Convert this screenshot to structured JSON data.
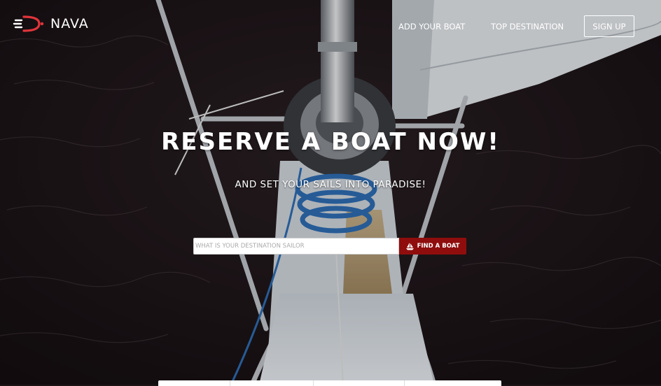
{
  "brand": {
    "name": "NAVA",
    "icon": "boat-logo-icon",
    "accent": "#e0353b"
  },
  "nav": {
    "add_boat": "ADD YOUR BOAT",
    "top_destination": "TOP DESTINATION",
    "sign_up": "SIGN UP"
  },
  "hero": {
    "title": "RESERVE A BOAT NOW!",
    "subtitle": "AND SET YOUR SAILS INTO PARADISE!"
  },
  "search": {
    "placeholder": "WHAT IS YOUR DESTINATION SAILOR",
    "value": "",
    "button_label": "FIND A BOAT",
    "button_icon": "sailboat-icon",
    "button_color": "#8f0d0d"
  },
  "colors": {
    "ocean": "#231a1d",
    "primary": "#8f0d0d"
  }
}
